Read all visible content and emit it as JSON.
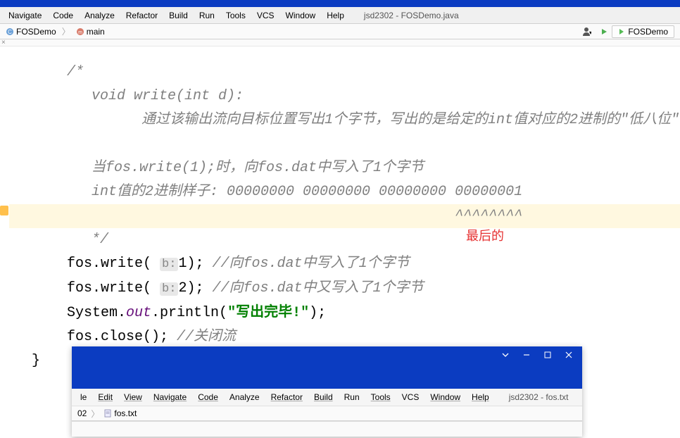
{
  "topbar_color": "#0b3cc1",
  "menu": [
    "Navigate",
    "Code",
    "Analyze",
    "Refactor",
    "Build",
    "Run",
    "Tools",
    "VCS",
    "Window",
    "Help"
  ],
  "window_title": "jsd2302 - FOSDemo.java",
  "breadcrumb": {
    "items": [
      "FOSDemo",
      "main"
    ],
    "right_tab": "FOSDemo"
  },
  "code": {
    "c1": "/*",
    "c2": " void write(int d):",
    "c3": "    通过该输出流向目标位置写出1个字节，写出的是给定的int值对应的2进制的\"低八位\"",
    "c4": " 当fos.write(1);时，向fos.dat中写入了1个字节",
    "c5": " int值的2进制样子: 00000000 00000000 00000000 00000001",
    "c6": "                                            ^^^^^^^^",
    "c7": " */",
    "l1a": "fos.write( ",
    "l1hint": "b:",
    "l1b": "1); ",
    "l1c": "//向fos.dat中写入了1个字节",
    "l2a": "fos.write( ",
    "l2hint": "b:",
    "l2b": "2); ",
    "l2c": "//向fos.dat中又写入了1个字节",
    "l3a": "System.",
    "l3b": "out",
    "l3c": ".println(",
    "l3str": "\"写出完毕!\"",
    "l3d": ");",
    "l4a": "fos.close(); ",
    "l4b": "//关闭流",
    "brace": "}",
    "annotation": "最后的"
  },
  "subwin": {
    "menu": [
      "le",
      "Edit",
      "View",
      "Navigate",
      "Code",
      "Analyze",
      "Refactor",
      "Build",
      "Run",
      "Tools",
      "VCS",
      "Window",
      "Help"
    ],
    "title": "jsd2302 - fos.txt",
    "breadcrumb": [
      "02",
      "fos.txt"
    ]
  }
}
